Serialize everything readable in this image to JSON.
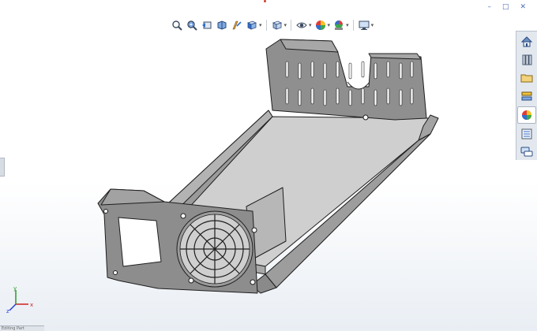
{
  "window": {
    "controls": [
      "–",
      "□",
      "✕"
    ]
  },
  "heads_up_toolbar": {
    "buttons": [
      {
        "icon": "zoom-to-fit-icon"
      },
      {
        "icon": "zoom-to-area-icon"
      },
      {
        "icon": "previous-view-icon"
      },
      {
        "icon": "section-view-icon"
      },
      {
        "icon": "dynamic-annotation-icon"
      },
      {
        "icon": "view-orientation-icon",
        "dropdown": true
      },
      {
        "icon": "display-style-icon",
        "dropdown": true
      },
      {
        "icon": "hide-show-items-icon",
        "dropdown": true
      },
      {
        "icon": "edit-appearance-icon",
        "dropdown": true
      },
      {
        "icon": "apply-scene-icon",
        "dropdown": true
      },
      {
        "icon": "view-settings-icon",
        "dropdown": true
      }
    ]
  },
  "task_pane": {
    "tabs": [
      {
        "icon": "home-icon"
      },
      {
        "icon": "design-library-icon"
      },
      {
        "icon": "file-explorer-icon"
      },
      {
        "icon": "view-palette-icon"
      },
      {
        "icon": "appearances-icon",
        "active": true
      },
      {
        "icon": "custom-properties-icon"
      },
      {
        "icon": "forum-icon"
      }
    ]
  },
  "status_bar": {
    "text": "Editing Part"
  },
  "triad": {
    "axes": [
      "x",
      "y",
      "z"
    ]
  },
  "model": {
    "name": "sheet-metal-enclosure"
  },
  "colors": {
    "accent": "#4a6bb5",
    "model_face": "#8f8f8f",
    "model_inner": "#cfcfcf",
    "model_edge": "#1e1e1e"
  }
}
